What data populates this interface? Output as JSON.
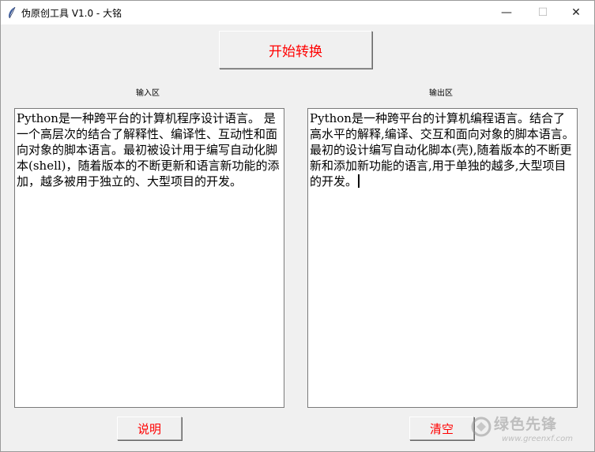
{
  "window": {
    "title": "伪原创工具 V1.0 - 大铭",
    "controls": {
      "minimize": "—",
      "maximize": "☐",
      "close": "✕"
    }
  },
  "toolbar": {
    "convert_label": "开始转换"
  },
  "input": {
    "label": "输入区",
    "text": "Python是一种跨平台的计算机程序设计语言。 是一个高层次的结合了解释性、编译性、互动性和面向对象的脚本语言。最初被设计用于编写自动化脚本(shell)，随着版本的不断更新和语言新功能的添加，越多被用于独立的、大型项目的开发。"
  },
  "output": {
    "label": "输出区",
    "text": "Python是一种跨平台的计算机编程语言。结合了高水平的解释,编译、交互和面向对象的脚本语言。最初的设计编写自动化脚本(壳),随着版本的不断更新和添加新功能的语言,用于单独的越多,大型项目的开发。"
  },
  "footer": {
    "help_label": "说明",
    "clear_label": "清空"
  },
  "watermark": {
    "text": "绿色先锋",
    "url": "www.greenxf.com"
  },
  "colors": {
    "button_text": "#ff0000",
    "window_bg": "#f0f0f0"
  }
}
